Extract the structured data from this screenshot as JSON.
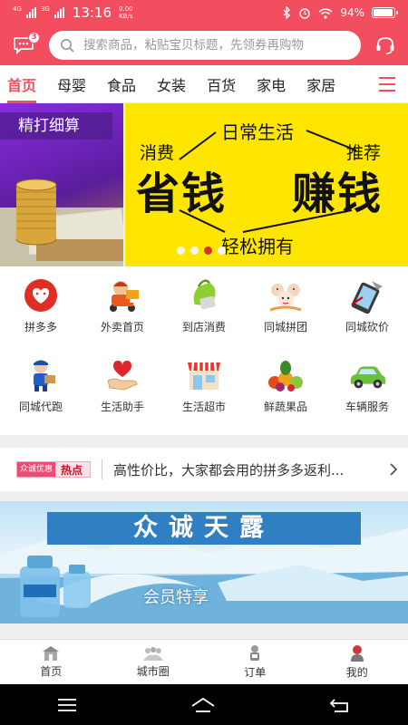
{
  "status_bar": {
    "net1": "4G",
    "net2": "3G",
    "time": "13:16",
    "speed_value": "0.00",
    "speed_unit": "KB/s",
    "battery": "94%",
    "battery_level": 0.94
  },
  "header": {
    "message_badge": "3",
    "search_placeholder": "搜索商品，粘贴宝贝标题，先领券再购物"
  },
  "tabs": [
    "首页",
    "母婴",
    "食品",
    "女装",
    "百货",
    "家电",
    "家居"
  ],
  "active_tab": 0,
  "banner": {
    "left_label": "精打细算",
    "words": [
      "日常生活",
      "消费",
      "推荐",
      "省钱",
      "赚钱",
      "轻松拥有"
    ],
    "slide_count": 4,
    "active_slide": 2
  },
  "services": [
    {
      "label": "拼多多",
      "icon": "pinduoduo-icon"
    },
    {
      "label": "外卖首页",
      "icon": "delivery-icon"
    },
    {
      "label": "到店消费",
      "icon": "shopping-bag-icon"
    },
    {
      "label": "同城拼团",
      "icon": "group-buy-icon"
    },
    {
      "label": "同城砍价",
      "icon": "bargain-icon"
    },
    {
      "label": "同城代跑",
      "icon": "courier-icon"
    },
    {
      "label": "生活助手",
      "icon": "helping-hand-icon"
    },
    {
      "label": "生活超市",
      "icon": "supermarket-icon"
    },
    {
      "label": "鲜蔬果品",
      "icon": "fruits-icon"
    },
    {
      "label": "车辆服务",
      "icon": "car-icon"
    }
  ],
  "hot": {
    "badge_a": "众诚优惠",
    "badge_b": "热点",
    "text": "高性价比，大家都会用的拼多多返利..."
  },
  "promo": {
    "title": "众诚天露",
    "subtitle": "会员特享"
  },
  "bottom_nav": [
    {
      "label": "首页",
      "icon": "home-icon"
    },
    {
      "label": "城市圈",
      "icon": "city-circle-icon"
    },
    {
      "label": "订单",
      "icon": "orders-icon"
    },
    {
      "label": "我的",
      "icon": "profile-icon"
    }
  ],
  "colors": {
    "brand": "#f24e60",
    "banner_yellow": "#ffe600"
  }
}
